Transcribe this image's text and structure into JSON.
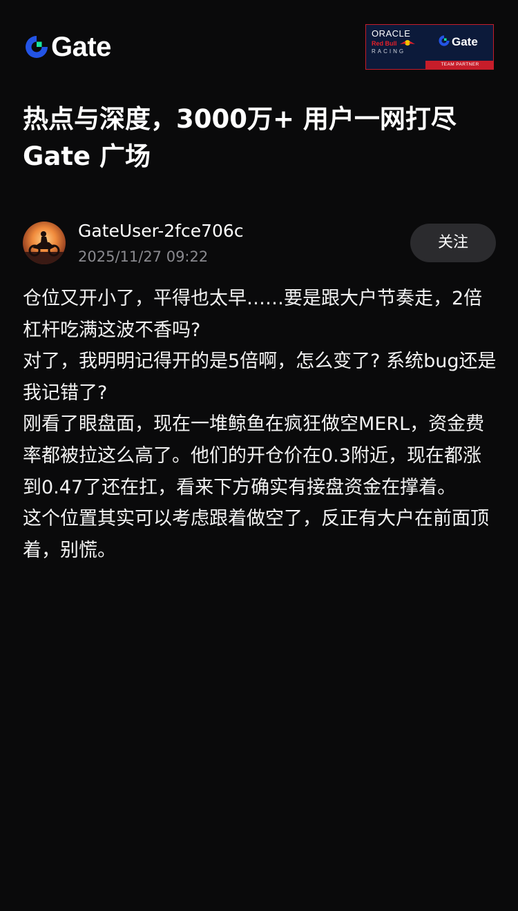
{
  "header": {
    "logo_text": "Gate",
    "logo_icon": "gate-logo-icon",
    "partner_badge": {
      "oracle": "ORACLE",
      "redbull": "Red Bull",
      "racing": "RACING",
      "gate": "Gate",
      "tag": "TEAM PARTNER"
    }
  },
  "headline": {
    "line1": "热点与深度，3000万+ 用户一网打尽",
    "line2": "Gate 广场"
  },
  "post": {
    "username": "GateUser-2fce706c",
    "timestamp": "2025/11/27 09:22",
    "follow_label": "关注",
    "avatar_icon": "motorcycle-avatar",
    "paragraphs": [
      "仓位又开小了，平得也太早……要是跟大户节奏走，2倍杠杆吃满这波不香吗?",
      "对了，我明明记得开的是5倍啊，怎么变了? 系统bug还是我记错了?",
      "刚看了眼盘面，现在一堆鲸鱼在疯狂做空MERL，资金费率都被拉这么高了。他们的开仓价在0.3附近，现在都涨到0.47了还在扛，看来下方确实有接盘资金在撑着。",
      "这个位置其实可以考虑跟着做空了，反正有大户在前面顶着，别慌。"
    ]
  },
  "colors": {
    "background": "#0a0a0b",
    "brand_blue": "#2354e6",
    "brand_green": "#17e5a0",
    "button_bg": "#2b2b2e",
    "muted_text": "#8a8a8f"
  }
}
